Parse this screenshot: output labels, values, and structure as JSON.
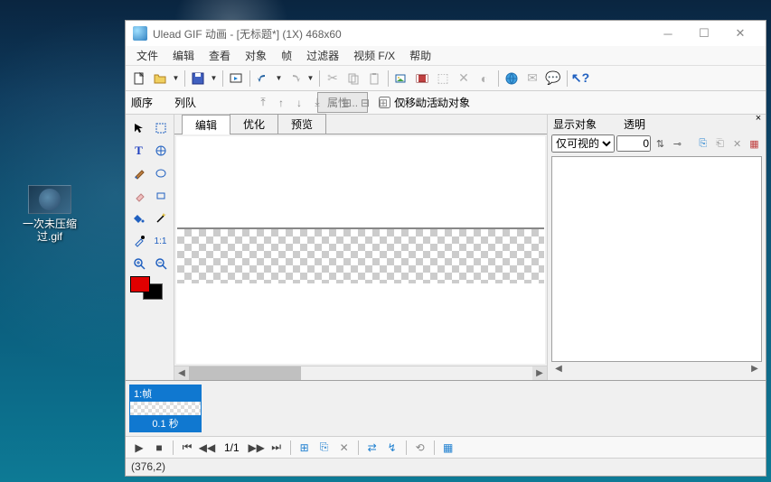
{
  "desktop": {
    "file_label": "一次未压缩过.gif"
  },
  "window": {
    "title": "Ulead GIF 动画 - [无标题*] (1X) 468x60"
  },
  "menu": {
    "file": "文件",
    "edit": "编辑",
    "view": "查看",
    "object": "对象",
    "frame": "帧",
    "filter": "过滤器",
    "videofx": "视频 F/X",
    "help": "帮助"
  },
  "seqbar": {
    "order": "顺序",
    "queue": "列队",
    "props": "属性...",
    "only_move": "仅移动活动对象"
  },
  "tabs": {
    "edit": "编辑",
    "optimize": "优化",
    "preview": "预览"
  },
  "right": {
    "show_obj": "显示对象",
    "transparent": "透明",
    "visible_only": "仅可视的",
    "transparent_val": "0"
  },
  "timeline": {
    "frame_label": "1:帧",
    "frame_time": "0.1 秒"
  },
  "playbar": {
    "counter": "1/1"
  },
  "status": {
    "coords": "(376,2)"
  }
}
